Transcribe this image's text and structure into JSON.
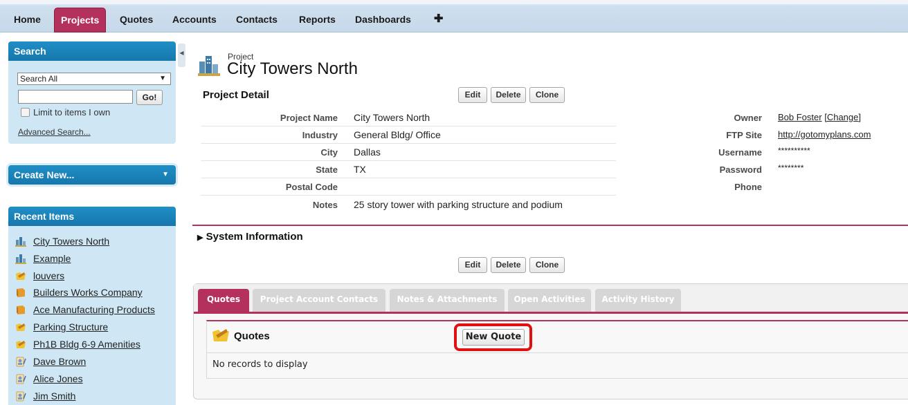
{
  "nav": {
    "tabs": [
      "Home",
      "Projects",
      "Quotes",
      "Accounts",
      "Contacts",
      "Reports",
      "Dashboards"
    ],
    "add_tab_icon": "plus-icon",
    "active_tab": "Projects",
    "accent_color": "#b5315d"
  },
  "sidebar": {
    "search": {
      "header": "Search",
      "scope_selected": "Search All",
      "input_value": "",
      "go_label": "Go!",
      "limit_label": "Limit to items I own",
      "limit_checked": false,
      "advanced_link": "Advanced Search..."
    },
    "create_new": {
      "label": "Create New..."
    },
    "recent": {
      "header": "Recent Items",
      "items": [
        {
          "label": "City Towers North",
          "icon": "project-icon"
        },
        {
          "label": "Example",
          "icon": "project-icon"
        },
        {
          "label": "louvers",
          "icon": "quote-icon"
        },
        {
          "label": "Builders Works Company",
          "icon": "account-icon"
        },
        {
          "label": "Ace Manufacturing Products",
          "icon": "account-icon"
        },
        {
          "label": "Parking Structure",
          "icon": "quote-icon"
        },
        {
          "label": "Ph1B Bldg 6-9 Amenities",
          "icon": "quote-icon"
        },
        {
          "label": "Dave Brown",
          "icon": "contact-icon"
        },
        {
          "label": "Alice Jones",
          "icon": "contact-icon"
        },
        {
          "label": "Jim Smith",
          "icon": "contact-icon"
        }
      ]
    }
  },
  "record": {
    "object_type": "Project",
    "title": "City Towers North",
    "detail_section": "Project Detail",
    "buttons": {
      "edit": "Edit",
      "delete": "Delete",
      "clone": "Clone"
    },
    "fields_left": [
      {
        "label": "Project Name",
        "value": "City Towers North"
      },
      {
        "label": "Industry",
        "value": "General Bldg/ Office"
      },
      {
        "label": "City",
        "value": "Dallas"
      },
      {
        "label": "State",
        "value": "TX"
      },
      {
        "label": "Postal Code",
        "value": ""
      },
      {
        "label": "Notes",
        "value": "25 story tower with parking structure and podium"
      }
    ],
    "fields_right": [
      {
        "label": "Owner",
        "value": "Bob Foster",
        "extra": "[Change]"
      },
      {
        "label": "FTP Site",
        "value": "http://gotomyplans.com"
      },
      {
        "label": "Username",
        "value": "**********"
      },
      {
        "label": "Password",
        "value": "********"
      },
      {
        "label": "Phone",
        "value": ""
      }
    ],
    "system_info": "System Information",
    "system_info_toggle": "▶"
  },
  "related": {
    "tabs": [
      "Quotes",
      "Project Account Contacts",
      "Notes & Attachments",
      "Open Activities",
      "Activity History"
    ],
    "active_tab": "Quotes",
    "quotes_list": {
      "title": "Quotes",
      "new_button": "New Quote",
      "empty_message": "No records to display"
    }
  }
}
